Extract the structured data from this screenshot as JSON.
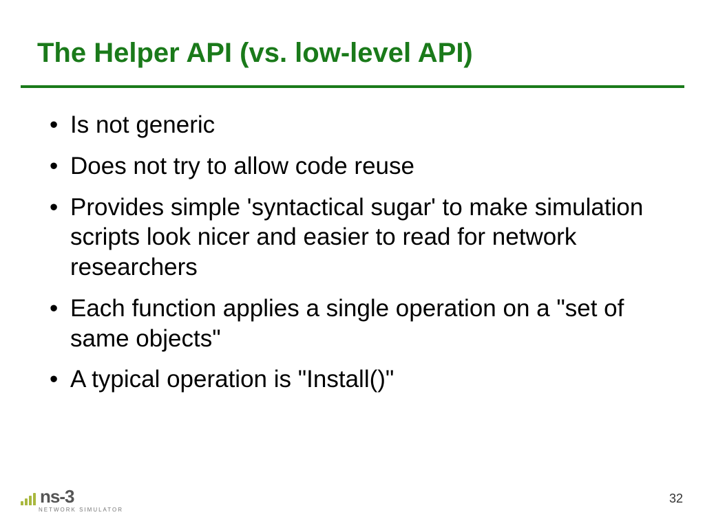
{
  "title": "The Helper API (vs. low-level API)",
  "bullets": [
    "Is not generic",
    "Does not try to allow code reuse",
    "Provides simple 'syntactical sugar' to make simulation scripts look nicer and easier to read for network researchers",
    "Each function applies a single operation on a \"set of same objects\"",
    "A typical operation is \"Install()\""
  ],
  "page_number": "32",
  "logo": {
    "name": "ns-3",
    "tagline": "NETWORK SIMULATOR"
  }
}
